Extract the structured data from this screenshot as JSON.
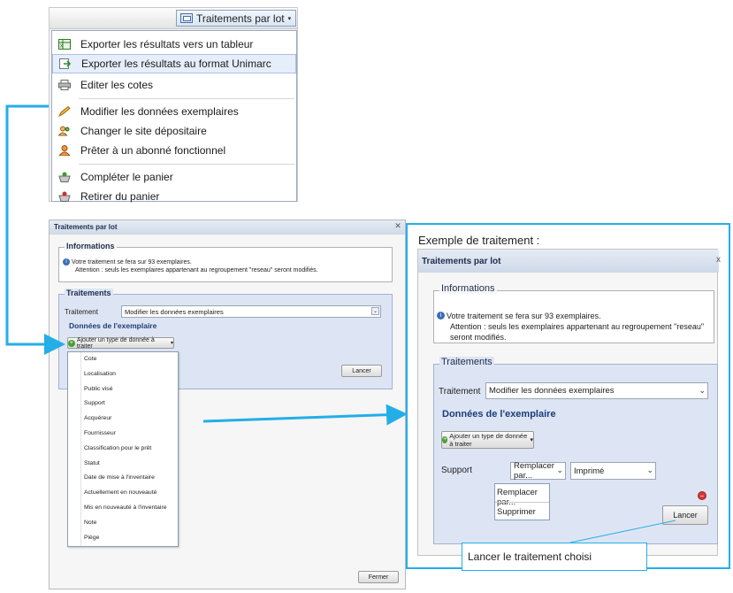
{
  "menu": {
    "button_label": "Traitements par lot",
    "items": [
      {
        "label": "Exporter les résultats vers un tableur",
        "icon": "spreadsheet-icon"
      },
      {
        "label": "Exporter les résultats au format Unimarc",
        "icon": "export-arrow-icon"
      },
      {
        "label": "Editer les cotes",
        "icon": "printer-icon"
      },
      {
        "label": "Modifier les données exemplaires",
        "icon": "pencil-icon"
      },
      {
        "label": "Changer le site dépositaire",
        "icon": "users-icon"
      },
      {
        "label": "Prêter à un abonné fonctionnel",
        "icon": "user-icon"
      },
      {
        "label": "Compléter le panier",
        "icon": "basket-add-icon"
      },
      {
        "label": "Retirer du panier",
        "icon": "basket-remove-icon"
      }
    ]
  },
  "dialog": {
    "title": "Traitements par lot",
    "close": "✕",
    "informations_legend": "Informations",
    "info_line1": "Votre traitement se fera sur 93 exemplaires.",
    "info_line2": "Attention : seuls les exemplaires appartenant au regroupement \"reseau\" seront modifiés.",
    "traitements_legend": "Traitements",
    "traitement_label": "Traitement",
    "traitement_value": "Modifier les données exemplaires",
    "donnees_heading": "Données de l'exemplaire",
    "add_type_button": "Ajouter un type de donnée à traiter",
    "lancer": "Lancer",
    "fermer": "Fermer",
    "dropdown_items": [
      "Cote",
      "Localisation",
      "Public visé",
      "Support",
      "Acquéreur",
      "Fournisseur",
      "Classification pour le prêt",
      "Statut",
      "Date de mise à l'inventaire",
      "Actuellement en nouveauté",
      "Mis en nouveauté à l'inventaire",
      "Note",
      "Piège"
    ]
  },
  "example": {
    "caption": "Exemple de traitement :",
    "title": "Traitements par lot",
    "close": "x",
    "informations_legend": "Informations",
    "info_line1": "Votre traitement se fera sur 93 exemplaires.",
    "info_line2": "Attention : seuls les exemplaires appartenant au regroupement \"reseau\" seront modifiés.",
    "traitements_legend": "Traitements",
    "traitement_label": "Traitement",
    "traitement_value": "Modifier les données exemplaires",
    "donnees_heading": "Données de l'exemplaire",
    "add_type_button": "Ajouter un type de donnée à traiter",
    "support_label": "Support",
    "action_value": "Remplacer par...",
    "support_value": "Imprimé",
    "action_options": [
      "Remplacer par...",
      "Supprimer"
    ],
    "lancer": "Lancer",
    "callout": "Lancer le traitement choisi"
  },
  "colors": {
    "accent": "#24aee7",
    "panel": "#dde5f4"
  }
}
